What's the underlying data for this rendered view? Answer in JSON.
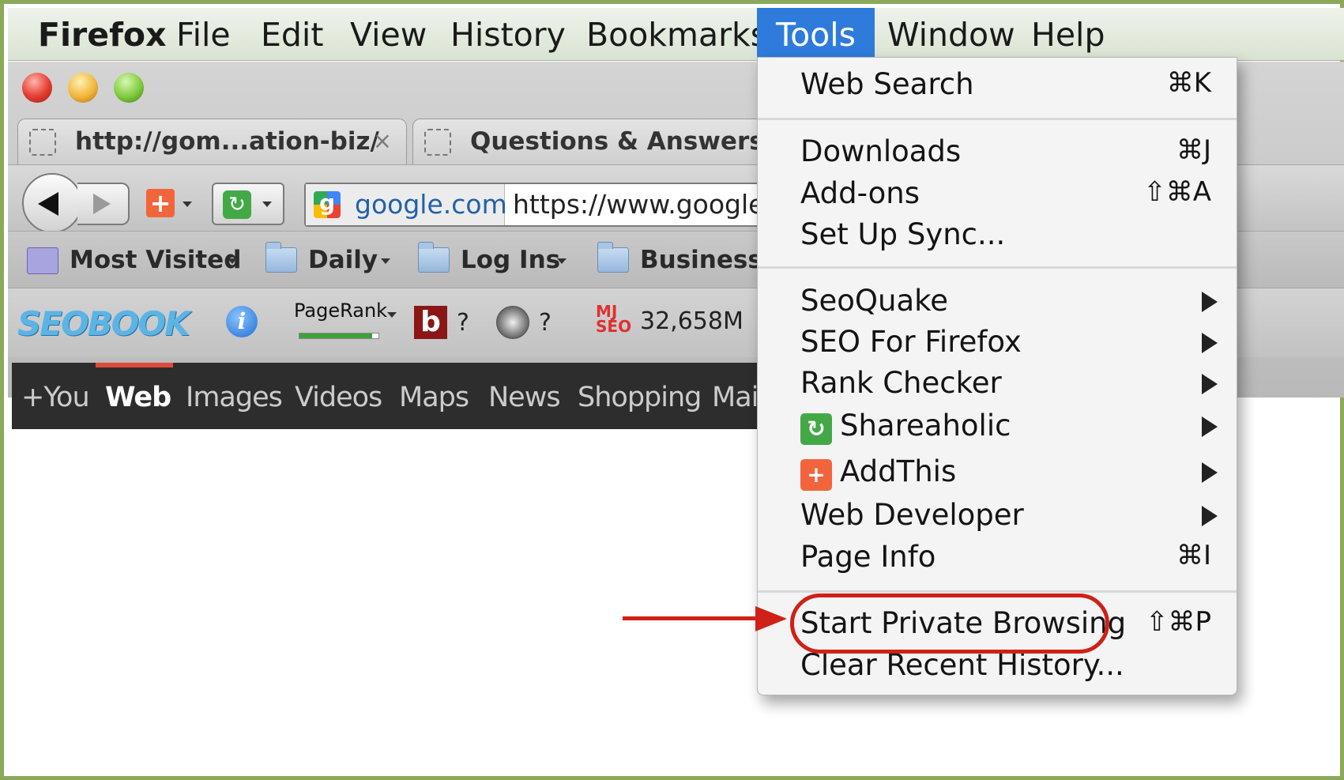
{
  "menubar": {
    "items": [
      "Firefox",
      "File",
      "Edit",
      "View",
      "History",
      "Bookmarks",
      "Tools",
      "Window",
      "Help"
    ],
    "active": "Tools"
  },
  "tabs": [
    {
      "label": "http://gom...ation-biz/",
      "close": "×"
    },
    {
      "label": "Questions & Answers ..."
    }
  ],
  "navbar": {
    "site_label": "google.com",
    "url": "https://www.google.c"
  },
  "bookmarks": [
    {
      "label": "Most Visited",
      "icon": "most-visited-icon"
    },
    {
      "label": "Daily",
      "icon": "folder-icon"
    },
    {
      "label": "Log Ins",
      "icon": "folder-icon"
    },
    {
      "label": "Business T",
      "icon": "folder-icon"
    }
  ],
  "seobar": {
    "logo": "SEOBOOK",
    "pagerank_label": "PageRank",
    "pagerank_level": 0.92,
    "q1": "?",
    "q2": "?",
    "mj_logo": "MJ\nSEO",
    "mj_value": "32,658M"
  },
  "google_bar": {
    "links": [
      "+You",
      "Web",
      "Images",
      "Videos",
      "Maps",
      "News",
      "Shopping",
      "Mai"
    ],
    "selected": "Web"
  },
  "tools_menu": {
    "groups": [
      [
        {
          "label": "Web Search",
          "shortcut": "⌘K"
        }
      ],
      [
        {
          "label": "Downloads",
          "shortcut": "⌘J"
        },
        {
          "label": "Add-ons",
          "shortcut": "⇧⌘A"
        },
        {
          "label": "Set Up Sync..."
        }
      ],
      [
        {
          "label": "SeoQuake",
          "submenu": true
        },
        {
          "label": "SEO For Firefox",
          "submenu": true
        },
        {
          "label": "Rank Checker",
          "submenu": true
        },
        {
          "label": "Shareaholic",
          "submenu": true,
          "icon": "shareaholic-icon"
        },
        {
          "label": "AddThis",
          "submenu": true,
          "icon": "addthis-icon"
        },
        {
          "label": "Web Developer",
          "submenu": true
        },
        {
          "label": "Page Info",
          "shortcut": "⌘I"
        }
      ],
      [
        {
          "label": "Start Private Browsing",
          "shortcut": "⇧⌘P",
          "highlighted": true
        },
        {
          "label": "Clear Recent History..."
        }
      ]
    ]
  },
  "colors": {
    "menubar_active": "#2e7bdc",
    "annotation_red": "#cf2117",
    "frame_green": "#8aaa5a",
    "google_bar_bg": "#2d2d2d",
    "google_selected_line": "#dd4b39"
  }
}
